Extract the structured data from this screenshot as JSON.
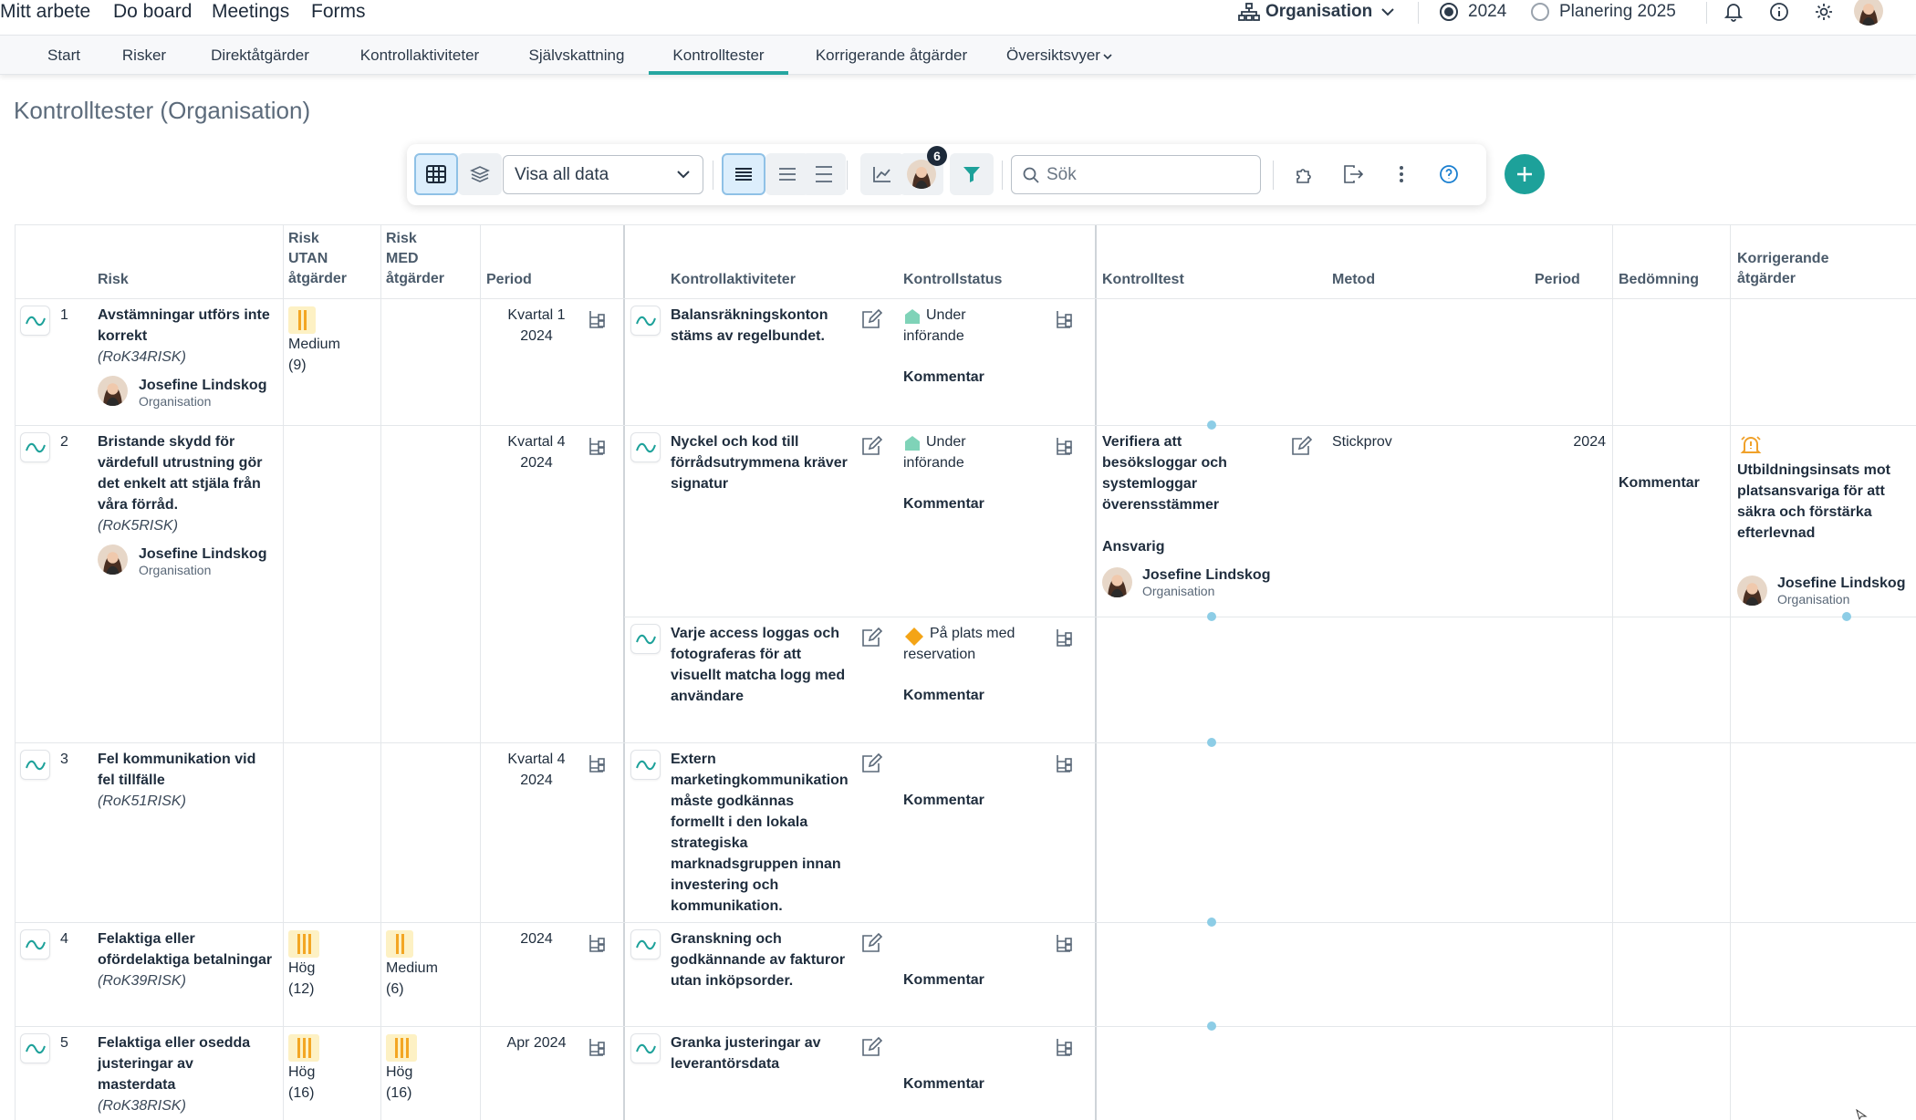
{
  "topnav": {
    "items": [
      "Mitt arbete",
      "Do board",
      "Meetings",
      "Forms"
    ],
    "org_label": "Organisation",
    "year_option": "2024",
    "plan_option": "Planering 2025"
  },
  "subnav": {
    "tabs": [
      "Start",
      "Risker",
      "Direktåtgärder",
      "Kontrollaktiviteter",
      "Självskattning",
      "Kontrolltester",
      "Korrigerande åtgärder",
      "Översiktsvyer"
    ],
    "active": "Kontrolltester"
  },
  "page": {
    "title": "Kontrolltester (Organisation)"
  },
  "toolbar": {
    "view_select": "Visa all data",
    "search_placeholder": "Sök",
    "avatar_badge": "6"
  },
  "table": {
    "headers": {
      "risk": "Risk",
      "risk_utan_1": "Risk",
      "risk_utan_2": "UTAN",
      "risk_utan_3": "åtgärder",
      "risk_med_1": "Risk",
      "risk_med_2": "MED",
      "risk_med_3": "åtgärder",
      "period": "Period",
      "kontrollaktiviteter": "Kontrollaktiviteter",
      "kontrollstatus": "Kontrollstatus",
      "kontrolltest": "Kontrolltest",
      "metod": "Metod",
      "period2": "Period",
      "bedomning": "Bedömning",
      "korr_1": "Korrigerande",
      "korr_2": "åtgärder"
    },
    "comment_label": "Kommentar",
    "owner_name": "Josefine Lindskog",
    "owner_org": "Organisation",
    "rows": [
      {
        "num": "1",
        "title_1": "Avstämningar utförs inte",
        "title_2": "korrekt",
        "code": "(RoK34RISK)",
        "utan_1": "Medium",
        "utan_2": "(9)",
        "period_1": "Kvartal 1",
        "period_2": "2024",
        "act_1": "Balansräkningskonton",
        "act_2": "stäms av regelbundet.",
        "status_1": "Under",
        "status_2": "införande"
      },
      {
        "num": "2",
        "title_1": "Bristande skydd för",
        "title_2": "värdefull utrustning gör",
        "title_3": "det enkelt att stjäla från",
        "title_4": "våra förråd.",
        "code": "(RoK5RISK)",
        "period_1": "Kvartal 4",
        "period_2": "2024",
        "act_1": "Nyckel och kod till",
        "act_2": "förrådsutrymmena kräver",
        "act_3": "signatur",
        "status_1": "Under",
        "status_2": "införande",
        "test_1": "Verifiera att",
        "test_2": "besöksloggar och",
        "test_3": "systemloggar",
        "test_4": "överensstämmer",
        "test_resp": "Ansvarig",
        "method": "Stickprov",
        "test_period": "2024",
        "assessment": "Kommentar",
        "korr_1": "Utbildningsinsats mot",
        "korr_2": "platsansvariga för att",
        "korr_3": "säkra och förstärka",
        "korr_4": "efterlevnad",
        "act2_1": "Varje access loggas och",
        "act2_2": "fotograferas för att",
        "act2_3": "visuellt matcha logg med",
        "act2_4": "användare",
        "status2_1": "På plats med",
        "status2_2": "reservation"
      },
      {
        "num": "3",
        "title_1": "Fel kommunikation vid",
        "title_2": "fel tillfälle",
        "code": "(RoK51RISK)",
        "period_1": "Kvartal 4",
        "period_2": "2024",
        "act_1": "Extern",
        "act_2": "marketingkommunikation",
        "act_3": "måste godkännas",
        "act_4": "formellt i den lokala",
        "act_5": "strategiska",
        "act_6": "marknadsgruppen innan",
        "act_7": "investering och",
        "act_8": "kommunikation."
      },
      {
        "num": "4",
        "title_1": "Felaktiga eller",
        "title_2": "ofördelaktiga betalningar",
        "code": "(RoK39RISK)",
        "utan_1": "Hög",
        "utan_2": "(12)",
        "med_1": "Medium",
        "med_2": "(6)",
        "period_1": "2024",
        "act_1": "Granskning och",
        "act_2": "godkännande av fakturor",
        "act_3": "utan inköpsorder."
      },
      {
        "num": "5",
        "title_1": "Felaktiga eller osedda",
        "title_2": "justeringar av",
        "title_3": "masterdata",
        "code": "(RoK38RISK)",
        "utan_1": "Hög",
        "utan_2": "(16)",
        "med_1": "Hög",
        "med_2": "(16)",
        "period_1": "Apr 2024",
        "act_1": "Granka justeringar av",
        "act_2": "leverantörsdata"
      }
    ]
  },
  "colors": {
    "accent": "#26a6a0",
    "severity_bar": "#f3a623",
    "severity_bg": "#fdf1c4",
    "status_under": "#7fd3b8",
    "status_reservation": "#f4a416"
  }
}
